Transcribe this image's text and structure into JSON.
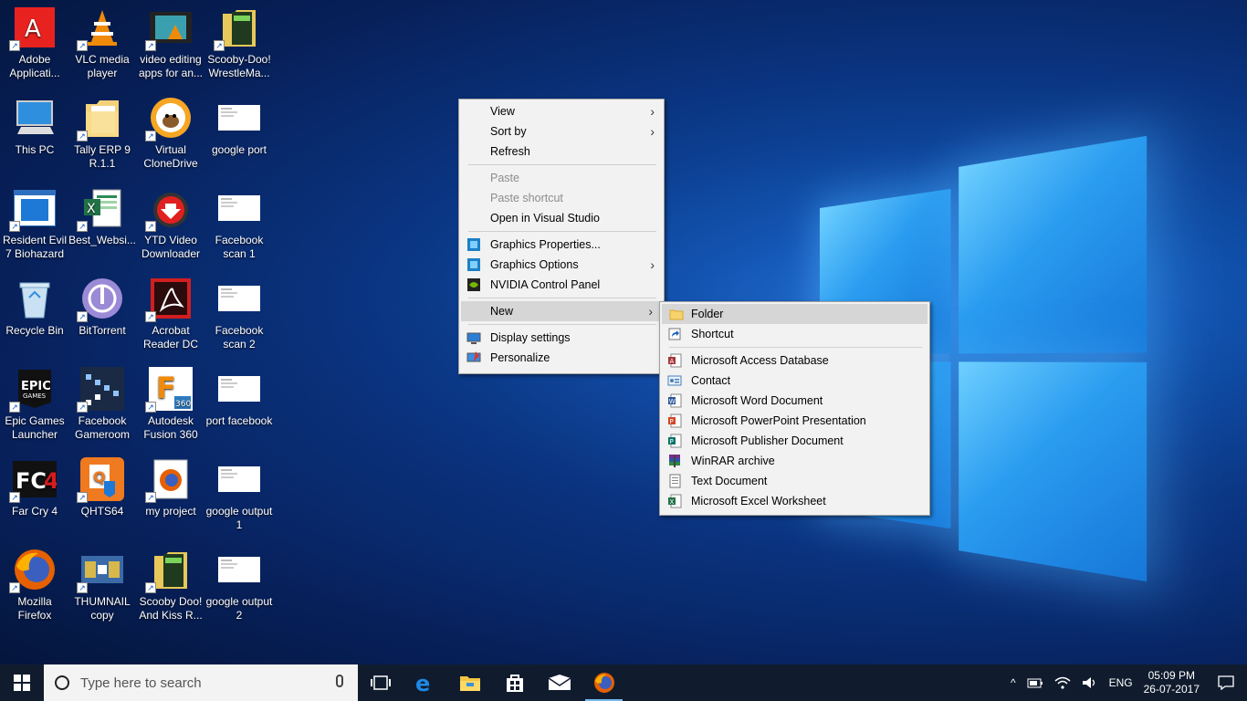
{
  "colors": {
    "menu_bg": "#f2f2f2",
    "menu_hover": "#d6d6d6",
    "taskbar_bg": "#101c2e",
    "accent": "#76b9ed"
  },
  "desktop": {
    "icons": [
      {
        "label": "Adobe Applicati...",
        "icon": "adobe-icon"
      },
      {
        "label": "VLC media player",
        "icon": "vlc-cone-icon"
      },
      {
        "label": "video editing apps for an...",
        "icon": "video-thumbnail-icon"
      },
      {
        "label": "Scooby-Doo! WrestleMa...",
        "icon": "game-folder-icon"
      },
      {
        "label": "This PC",
        "icon": "computer-icon"
      },
      {
        "label": "Tally ERP 9 R.1.1",
        "icon": "folder-icon"
      },
      {
        "label": "Virtual CloneDrive",
        "icon": "sheep-icon"
      },
      {
        "label": "google port",
        "icon": "document-thumbnail-icon"
      },
      {
        "label": "Resident Evil 7 Biohazard",
        "icon": "window-app-icon"
      },
      {
        "label": "Best_Websi...",
        "icon": "excel-file-icon"
      },
      {
        "label": "YTD Video Downloader",
        "icon": "ytd-downloader-icon"
      },
      {
        "label": "Facebook scan 1",
        "icon": "document-thumbnail-icon"
      },
      {
        "label": "Recycle Bin",
        "icon": "recycle-bin-icon"
      },
      {
        "label": "BitTorrent",
        "icon": "bittorrent-icon"
      },
      {
        "label": "Acrobat Reader DC",
        "icon": "acrobat-icon"
      },
      {
        "label": "Facebook scan 2",
        "icon": "document-thumbnail-icon"
      },
      {
        "label": "Epic Games Launcher",
        "icon": "epic-games-icon"
      },
      {
        "label": "Facebook Gameroom",
        "icon": "gameroom-icon"
      },
      {
        "label": "Autodesk Fusion 360",
        "icon": "fusion360-icon"
      },
      {
        "label": "port facebook",
        "icon": "document-thumbnail-icon"
      },
      {
        "label": "Far Cry 4",
        "icon": "farcry4-icon"
      },
      {
        "label": "QHTS64",
        "icon": "qhts-icon"
      },
      {
        "label": "my project",
        "icon": "firefox-file-icon"
      },
      {
        "label": "google output 1",
        "icon": "document-thumbnail-icon"
      },
      {
        "label": "Mozilla Firefox",
        "icon": "firefox-icon"
      },
      {
        "label": "THUMNAIL copy",
        "icon": "image-thumbnail-icon"
      },
      {
        "label": "Scooby Doo! And Kiss R...",
        "icon": "game-folder-icon"
      },
      {
        "label": "google output 2",
        "icon": "document-thumbnail-icon"
      }
    ]
  },
  "context_menu": {
    "view": "View",
    "sort_by": "Sort by",
    "refresh": "Refresh",
    "paste": "Paste",
    "paste_shortcut": "Paste shortcut",
    "open_vs": "Open in Visual Studio",
    "graphics_properties": "Graphics Properties...",
    "graphics_options": "Graphics Options",
    "nvidia": "NVIDIA Control Panel",
    "new": "New",
    "display_settings": "Display settings",
    "personalize": "Personalize"
  },
  "new_submenu": {
    "folder": "Folder",
    "shortcut": "Shortcut",
    "access": "Microsoft Access Database",
    "contact": "Contact",
    "word": "Microsoft Word Document",
    "powerpoint": "Microsoft PowerPoint Presentation",
    "publisher": "Microsoft Publisher Document",
    "winrar": "WinRAR archive",
    "text": "Text Document",
    "excel": "Microsoft Excel Worksheet"
  },
  "taskbar": {
    "search_placeholder": "Type here to search",
    "language": "ENG",
    "time": "05:09 PM",
    "date": "26-07-2017"
  }
}
